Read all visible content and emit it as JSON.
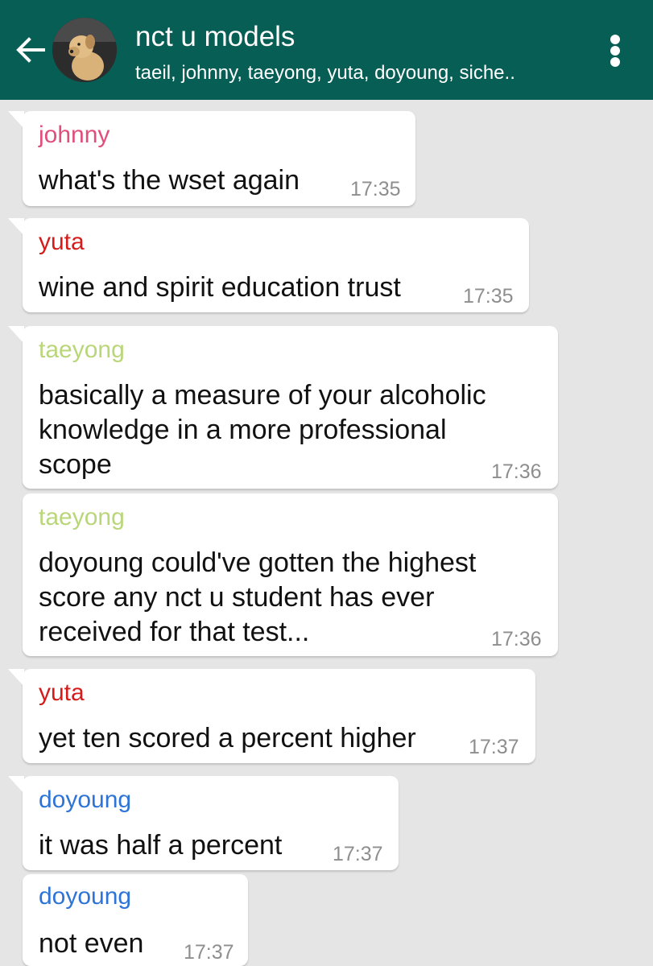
{
  "header": {
    "back_icon": "arrow-left-icon",
    "title": "nct u models",
    "participants": "taeil, johnny, taeyong, yuta, doyoung, siche..",
    "menu_icon": "more-vert-icon",
    "bg_color": "#075e54"
  },
  "messages": [
    {
      "sender": "johnny",
      "sender_color": "#e04f7a",
      "lines": [
        "what's the wset again"
      ],
      "time": "17:35"
    },
    {
      "sender": "yuta",
      "sender_color": "#d51c1c",
      "lines": [
        "wine and spirit education trust"
      ],
      "time": "17:35"
    },
    {
      "sender": "taeyong",
      "sender_color": "#b9d67a",
      "lines": [
        "basically a measure of your alcoholic",
        "knowledge in a more professional",
        "scope"
      ],
      "time": "17:36"
    },
    {
      "sender": "taeyong",
      "sender_color": "#b9d67a",
      "lines": [
        "doyoung could've gotten the highest",
        "score any nct u student has ever",
        "received for that test..."
      ],
      "time": "17:36"
    },
    {
      "sender": "yuta",
      "sender_color": "#d51c1c",
      "lines": [
        "yet ten scored a percent higher"
      ],
      "time": "17:37"
    },
    {
      "sender": "doyoung",
      "sender_color": "#2d74d6",
      "lines": [
        "it was half a percent"
      ],
      "time": "17:37"
    },
    {
      "sender": "doyoung",
      "sender_color": "#2d74d6",
      "lines": [
        "not even"
      ],
      "time": "17:37"
    }
  ]
}
